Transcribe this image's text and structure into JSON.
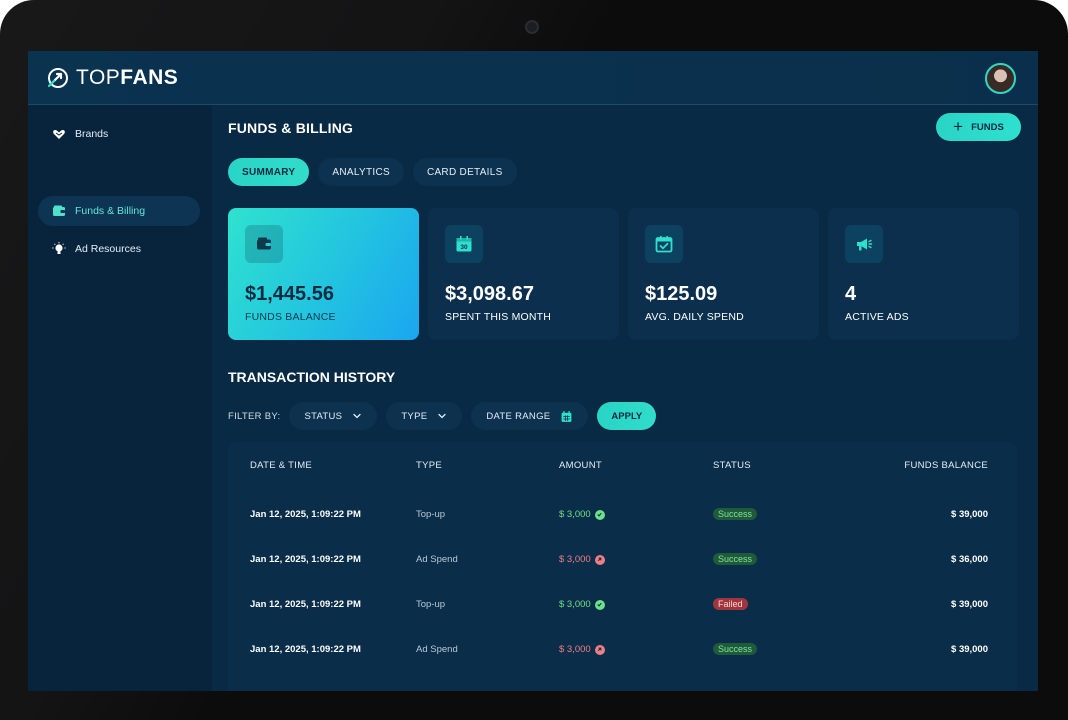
{
  "app": {
    "logo_prefix": "TOP",
    "logo_suffix": "FANS"
  },
  "sidebar": {
    "items": [
      {
        "label": "Brands",
        "icon": "heart-hand-icon",
        "active": false
      },
      {
        "label": "Funds & Billing",
        "icon": "wallet-icon",
        "active": true
      },
      {
        "label": "Ad Resources",
        "icon": "lightbulb-icon",
        "active": false
      }
    ]
  },
  "header": {
    "title": "FUNDS & BILLING",
    "funds_button": "FUNDS"
  },
  "tabs": [
    {
      "label": "SUMMARY",
      "active": true
    },
    {
      "label": "ANALYTICS",
      "active": false
    },
    {
      "label": "CARD DETAILS",
      "active": false
    }
  ],
  "cards": [
    {
      "value": "$1,445.56",
      "label": "FUNDS BALANCE",
      "icon": "wallet-icon"
    },
    {
      "value": "$3,098.67",
      "label": "SPENT THIS MONTH",
      "icon": "calendar-30-icon"
    },
    {
      "value": "$125.09",
      "label": "AVG. DAILY SPEND",
      "icon": "calendar-check-icon"
    },
    {
      "value": "4",
      "label": "ACTIVE ADS",
      "icon": "megaphone-icon"
    }
  ],
  "transactions": {
    "title": "TRANSACTION HISTORY",
    "filter_label": "FILTER BY:",
    "filters": [
      "STATUS",
      "TYPE",
      "DATE RANGE"
    ],
    "apply": "APPLY",
    "columns": [
      "DATE & TIME",
      "TYPE",
      "AMOUNT",
      "STATUS",
      "FUNDS BALANCE"
    ],
    "rows": [
      {
        "date": "Jan 12, 2025, 1:09:22 PM",
        "type": "Top-up",
        "amount": "$ 3,000",
        "direction": "in",
        "status": "Success",
        "balance": "$ 39,000"
      },
      {
        "date": "Jan 12, 2025, 1:09:22 PM",
        "type": "Ad Spend",
        "amount": "$ 3,000",
        "direction": "out",
        "status": "Success",
        "balance": "$ 36,000"
      },
      {
        "date": "Jan 12, 2025, 1:09:22 PM",
        "type": "Top-up",
        "amount": "$ 3,000",
        "direction": "in",
        "status": "Failed",
        "balance": "$ 39,000"
      },
      {
        "date": "Jan 12, 2025, 1:09:22 PM",
        "type": "Ad Spend",
        "amount": "$ 3,000",
        "direction": "out",
        "status": "Success",
        "balance": "$ 39,000"
      }
    ]
  },
  "colors": {
    "accent": "#2ad4c6",
    "background": "#082a45",
    "success": "#6ee08a",
    "danger": "#ef7f85"
  }
}
